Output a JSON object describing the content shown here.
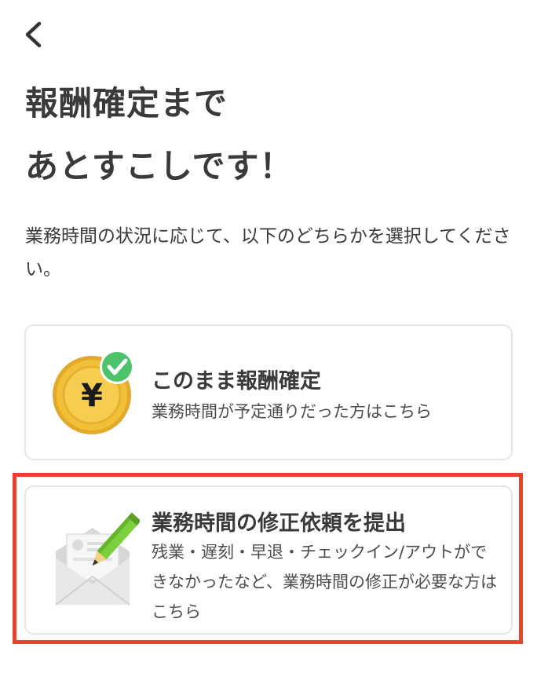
{
  "header": {
    "back_icon": "chevron-left-icon",
    "title_line1": "報酬確定まで",
    "title_line2": "あとすこしです！"
  },
  "instruction": "業務時間の状況に応じて、以下のどちらかを選択してください。",
  "options": [
    {
      "icon": "yen-coin-check-icon",
      "title": "このまま報酬確定",
      "description": "業務時間が予定通りだった方はこちら"
    },
    {
      "icon": "envelope-pencil-icon",
      "title": "業務時間の修正依頼を提出",
      "description": "残業・遅刻・早退・チェックイン/アウトができなかったなど、業務時間の修正が必要な方はこちら"
    }
  ],
  "coin_symbol": "¥",
  "colors": {
    "highlight": "#e8432c",
    "coin": "#f2c037",
    "check": "#4cc26b",
    "pencil": "#7ccf3d"
  }
}
